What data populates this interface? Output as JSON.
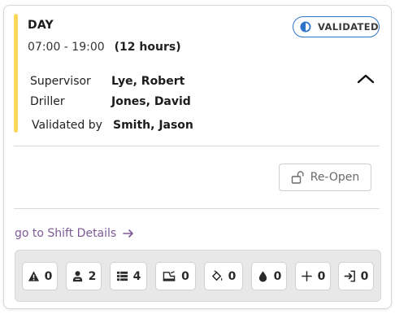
{
  "shift": {
    "name": "DAY",
    "time_range": "07:00 - 19:00",
    "duration": "(12 hours)",
    "status_badge": "VALIDATED",
    "accent_color": "#fbd75a",
    "badge_border_color": "#2f73c8"
  },
  "crew": [
    {
      "label": "Supervisor",
      "value": "Lye, Robert"
    },
    {
      "label": "Driller",
      "value": "Jones, David"
    },
    {
      "label": "Validated by",
      "value": "Smith, Jason"
    }
  ],
  "actions": {
    "reopen_label": "Re-Open",
    "reopen_icon": "unlock-icon",
    "collapse_icon": "chevron-up-icon"
  },
  "details_link": {
    "label": "go to Shift Details",
    "icon": "arrow-right-icon",
    "color": "#7d5a96"
  },
  "stats": [
    {
      "icon": "warning-icon",
      "count": "0"
    },
    {
      "icon": "person-icon",
      "count": "2"
    },
    {
      "icon": "list-icon",
      "count": "4"
    },
    {
      "icon": "drill-rig-icon",
      "count": "0"
    },
    {
      "icon": "paint-bucket-icon",
      "count": "0"
    },
    {
      "icon": "water-drop-icon",
      "count": "0"
    },
    {
      "icon": "plus-icon",
      "count": "0"
    },
    {
      "icon": "sign-in-icon",
      "count": "0"
    }
  ]
}
